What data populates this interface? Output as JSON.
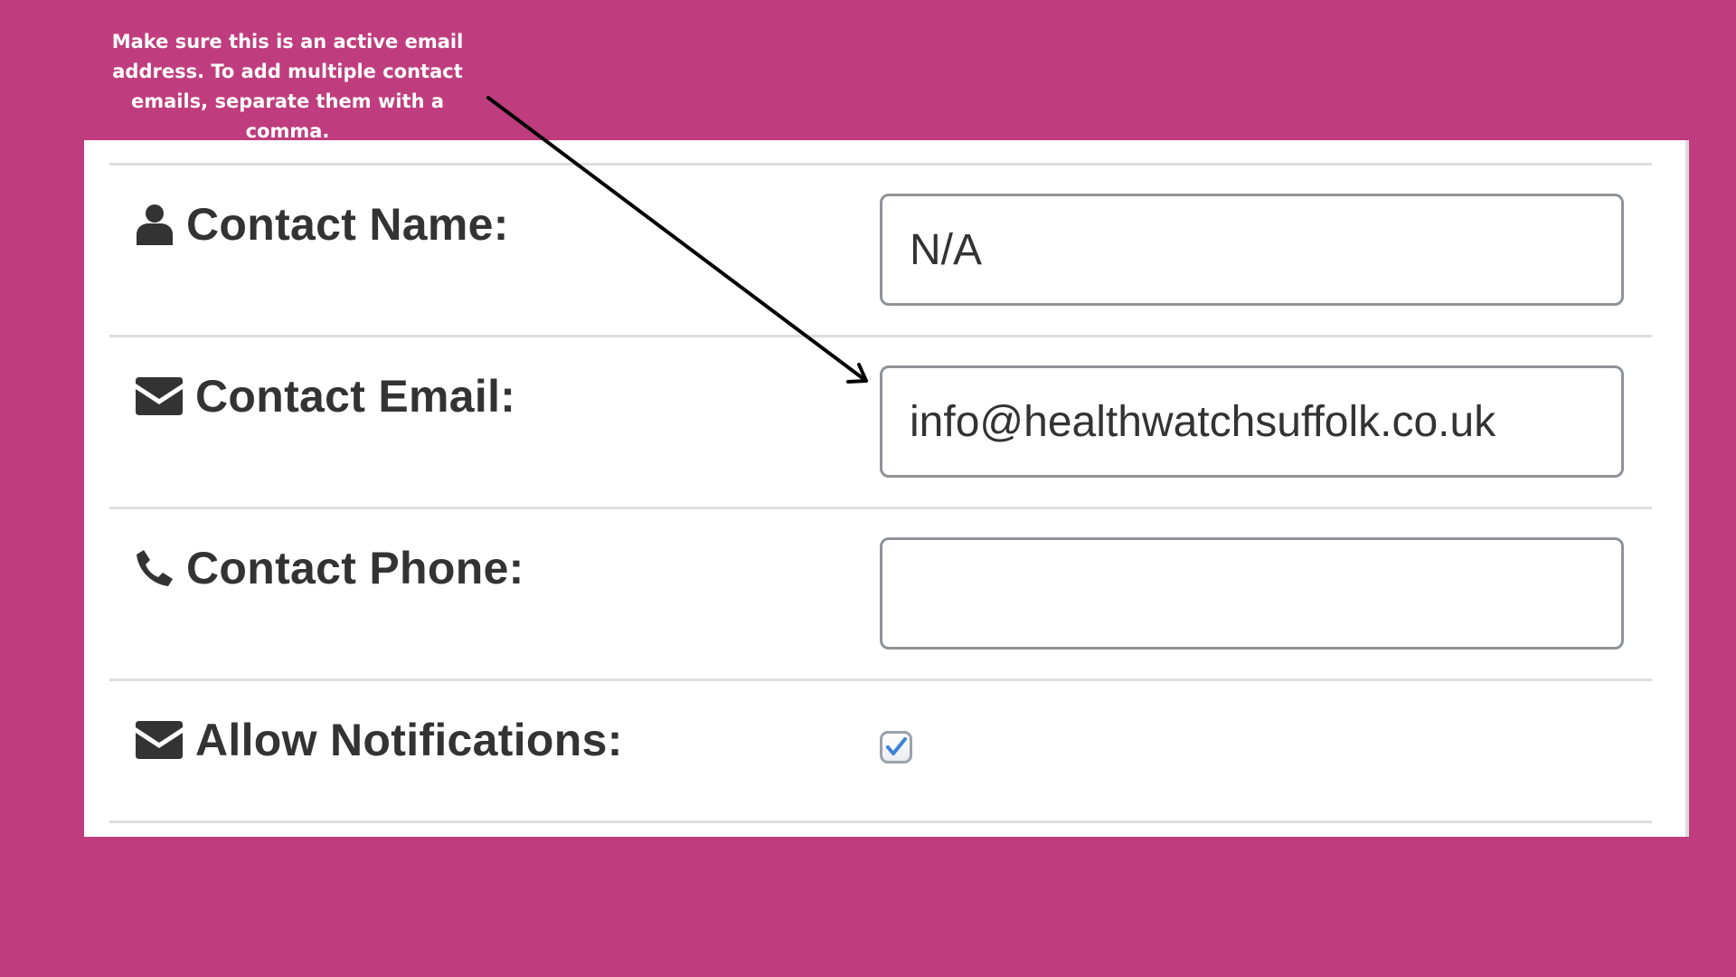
{
  "annotation": {
    "line1": "Make sure this is an active email",
    "line2": "address. To add multiple contact",
    "line3": "emails, separate them with a comma."
  },
  "form": {
    "contact_name": {
      "label": "Contact Name:",
      "value": "N/A",
      "icon": "user-icon"
    },
    "contact_email": {
      "label": "Contact Email:",
      "value": "info@healthwatchsuffolk.co.uk",
      "icon": "envelope-icon"
    },
    "contact_phone": {
      "label": "Contact Phone:",
      "value": "",
      "icon": "phone-icon"
    },
    "allow_notifications": {
      "label": "Allow Notifications:",
      "checked": true,
      "icon": "envelope-icon"
    }
  },
  "colors": {
    "background": "#BF3D7E",
    "panel": "#FFFFFF",
    "label_text": "#333333",
    "check_mark": "#3B82D6"
  }
}
